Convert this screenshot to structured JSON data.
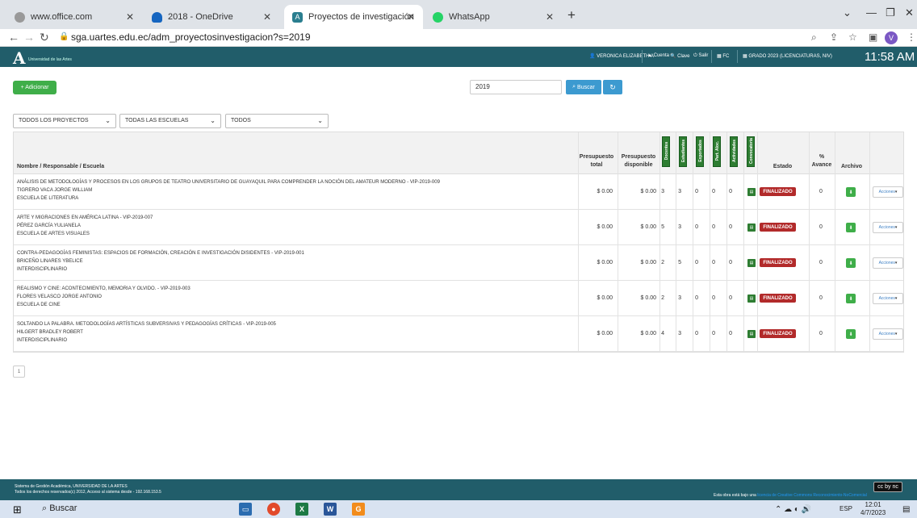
{
  "browser": {
    "tabs": [
      {
        "label": "www.office.com",
        "color": "#888888"
      },
      {
        "label": "2018 - OneDrive",
        "color": "#1565c0"
      },
      {
        "label": "Proyectos de investigación",
        "color": "#2a7e8f"
      },
      {
        "label": "WhatsApp",
        "color": "#25d366"
      }
    ],
    "url": "sga.uartes.edu.ec/adm_proyectosinvestigacion?s=2019",
    "avatar_letter": "V"
  },
  "header": {
    "logo_letter": "A",
    "logo_text": "Universidad de las Artes",
    "user": "VERONICA ELIZABETH A",
    "cuenta": "Cuenta",
    "clave": "Clave",
    "salir": "Salir",
    "fc": "FC",
    "periodo": "GRADO 2023 (LICENCIATURAS, NIV)",
    "time": "11:58 AM"
  },
  "toolbar": {
    "add_label": "+ Adicionar",
    "search_value": "2019",
    "search_label": "Buscar"
  },
  "filters": [
    {
      "label": "TODOS LOS PROYECTOS"
    },
    {
      "label": "TODAS LAS ESCUELAS"
    },
    {
      "label": "TODOS"
    }
  ],
  "table": {
    "headers": {
      "name": "Nombre / Responsable / Escuela",
      "total_1": "Presupuesto",
      "total_2": "total",
      "disp_1": "Presupuesto",
      "disp_2": "disponible",
      "v1": "Docentes",
      "v2": "Estudiantes",
      "v3": "Exportados",
      "v4": "Part. Aloc.",
      "v5": "Actividades",
      "v6": "Convocatoria",
      "estado": "Estado",
      "avance_1": "%",
      "avance_2": "Avance",
      "archivo": "Archivo"
    },
    "rows": [
      {
        "title": "ANÁLISIS DE METODOLOGÍAS Y PROCESOS EN LOS GRUPOS DE TEATRO UNIVERSITARIO DE GUAYAQUIL PARA COMPRENDER LA NOCIÓN DEL AMATEUR MODERNO - VIP-2019-009",
        "responsable": "TIGRERO VACA JORGE WILLIAM",
        "escuela": "ESCUELA DE LITERATURA",
        "total": "$ 0.00",
        "disponible": "$ 0.00",
        "c1": "3",
        "c2": "3",
        "c3": "0",
        "c4": "0",
        "c5": "0",
        "estado": "FINALIZADO",
        "avance": "0",
        "acciones": "Acciones"
      },
      {
        "title": "ARTE Y MIGRACIONES EN AMÉRICA LATINA - VIP-2019-007",
        "responsable": "PÉREZ GARCÍA YULIANELA",
        "escuela": "ESCUELA DE ARTES VISUALES",
        "total": "$ 0.00",
        "disponible": "$ 0.00",
        "c1": "5",
        "c2": "3",
        "c3": "0",
        "c4": "0",
        "c5": "0",
        "estado": "FINALIZADO",
        "avance": "0",
        "acciones": "Acciones"
      },
      {
        "title": "CONTRA-PEDAGOGÍAS FEMINISTAS: ESPACIOS DE FORMACIÓN, CREACIÓN E INVESTIGACIÓN DISIDENTES - VIP-2019-001",
        "responsable": "BRICEÑO LINARES YBELICE",
        "escuela": "INTERDISCIPLINARIO",
        "total": "$ 0.00",
        "disponible": "$ 0.00",
        "c1": "2",
        "c2": "5",
        "c3": "0",
        "c4": "0",
        "c5": "0",
        "estado": "FINALIZADO",
        "avance": "0",
        "acciones": "Acciones"
      },
      {
        "title": "REALISMO Y CINE: ACONTECIMIENTO, MEMORIA Y OLVIDO. - VIP-2019-003",
        "responsable": "FLORES VELASCO JORGE ANTONIO",
        "escuela": "ESCUELA DE CINE",
        "total": "$ 0.00",
        "disponible": "$ 0.00",
        "c1": "2",
        "c2": "3",
        "c3": "0",
        "c4": "0",
        "c5": "0",
        "estado": "FINALIZADO",
        "avance": "0",
        "acciones": "Acciones"
      },
      {
        "title": "SOLTANDO LA PALABRA. METODOLOGÍAS ARTÍSTICAS SUBVERSIVAS Y PEDAGOGÍAS CRÍTICAS - VIP-2019-005",
        "responsable": "HILGERT BRADLEY ROBERT",
        "escuela": "INTERDISCIPLINARIO",
        "total": "$ 0.00",
        "disponible": "$ 0.00",
        "c1": "4",
        "c2": "3",
        "c3": "0",
        "c4": "0",
        "c5": "0",
        "estado": "FINALIZADO",
        "avance": "0",
        "acciones": "Acciones"
      }
    ]
  },
  "pager": {
    "current": "1"
  },
  "footer": {
    "line1": "Sistema de Gestión Académica, UNIVERSIDAD DE LA ARTES",
    "line2": "Todos los derechos reservados(c) 2012, Acceso al sistema desde - 192.168.153.5",
    "license_prefix": "Esta obra está bajo una",
    "license_link": "licencia de Creative Commons Reconocimiento-NoComercial",
    "cc_label": "cc by nc"
  },
  "taskbar": {
    "search": "Buscar",
    "lang": "ESP",
    "time": "12:01",
    "date": "4/7/2023"
  },
  "colors": {
    "teal": "#215d6a",
    "green": "#3fae49",
    "blue": "#3c9ad0",
    "red": "#b22a2a"
  }
}
